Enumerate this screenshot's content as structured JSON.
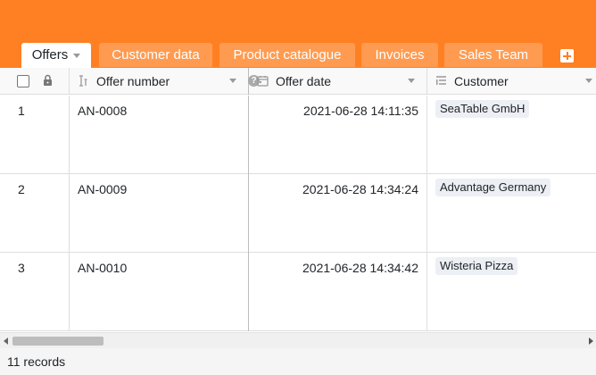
{
  "tabs": [
    {
      "label": "Offers",
      "active": true
    },
    {
      "label": "Customer data"
    },
    {
      "label": "Product catalogue"
    },
    {
      "label": "Invoices"
    },
    {
      "label": "Sales Team"
    }
  ],
  "columns": {
    "offer_number": "Offer number",
    "offer_date": "Offer date",
    "customer": "Customer"
  },
  "icons": {
    "offer_number": "text-field-icon",
    "offer_date": "calendar-icon",
    "customer": "link-icon",
    "lock": "lock-icon",
    "help": "help-icon"
  },
  "rows": [
    {
      "index": "1",
      "offer_number": "AN-0008",
      "offer_date": "2021-06-28 14:11:35",
      "customer": "SeaTable GmbH"
    },
    {
      "index": "2",
      "offer_number": "AN-0009",
      "offer_date": "2021-06-28 14:34:24",
      "customer": "Advantage Germany"
    },
    {
      "index": "3",
      "offer_number": "AN-0010",
      "offer_date": "2021-06-28 14:34:42",
      "customer": "Wisteria Pizza"
    }
  ],
  "footer": {
    "records": "11 records"
  },
  "colors": {
    "accent": "#ff8023",
    "tab_inactive": "#ff9b50"
  }
}
